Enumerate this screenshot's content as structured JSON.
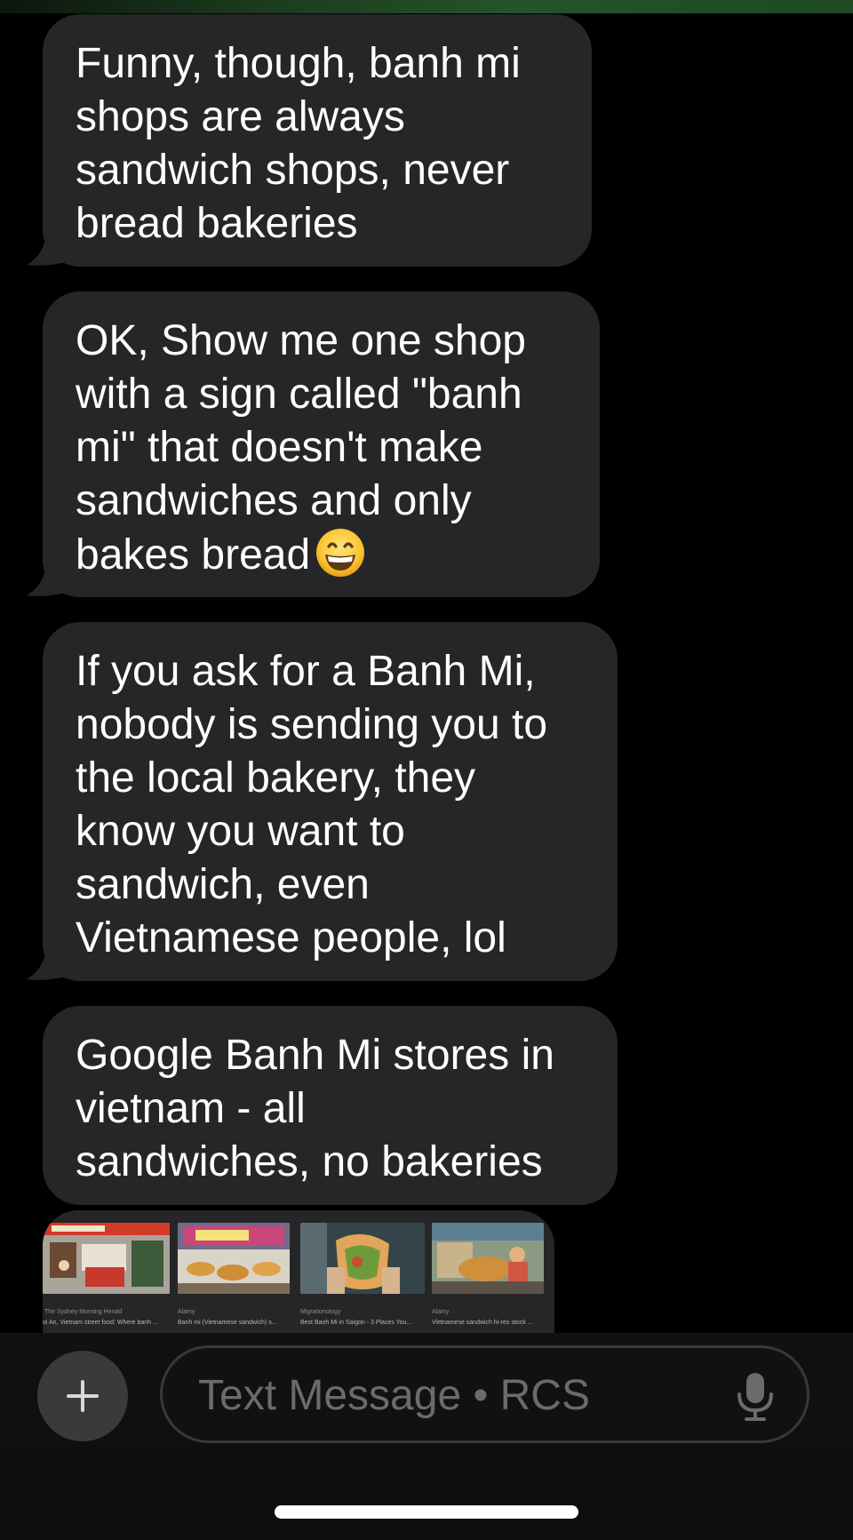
{
  "messages": [
    {
      "text": "Funny, though, banh mi\nshops are always\nsandwich shops, never\nbread bakeries"
    },
    {
      "text": "OK, Show me one shop\nwith a sign called \"banh\nmi\" that doesn't make\nsandwiches and only\nbakes bread",
      "emoji": "grinning-face-with-smiling-eyes"
    },
    {
      "text": "If you ask for a Banh Mi,\nnobody is sending you to\nthe local bakery, they\nknow you want to\nsandwich, even\nVietnamese people, lol"
    },
    {
      "text": "Google Banh Mi stores in\nvietnam - all\nsandwiches, no bakeries"
    }
  ],
  "image_preview": {
    "thumbnails": [
      {
        "source": "The Sydney Morning Herald",
        "caption": "oi An, Vietnam street food: Where banh ..."
      },
      {
        "source": "Alamy",
        "caption": "Banh mi (Vietnamese sandwich) s..."
      },
      {
        "source": "Migrationology",
        "caption": "Best Banh Mi in Saigon - 3 Places You..."
      },
      {
        "source": "Alamy",
        "caption": "Vietnamese sandwich hi-res stock ..."
      }
    ]
  },
  "composer": {
    "placeholder": "Text Message • RCS",
    "add_icon": "plus-icon",
    "mic_icon": "microphone-icon"
  },
  "colors": {
    "bubble": "#262629",
    "background": "#000000",
    "accent": "#24542a"
  }
}
